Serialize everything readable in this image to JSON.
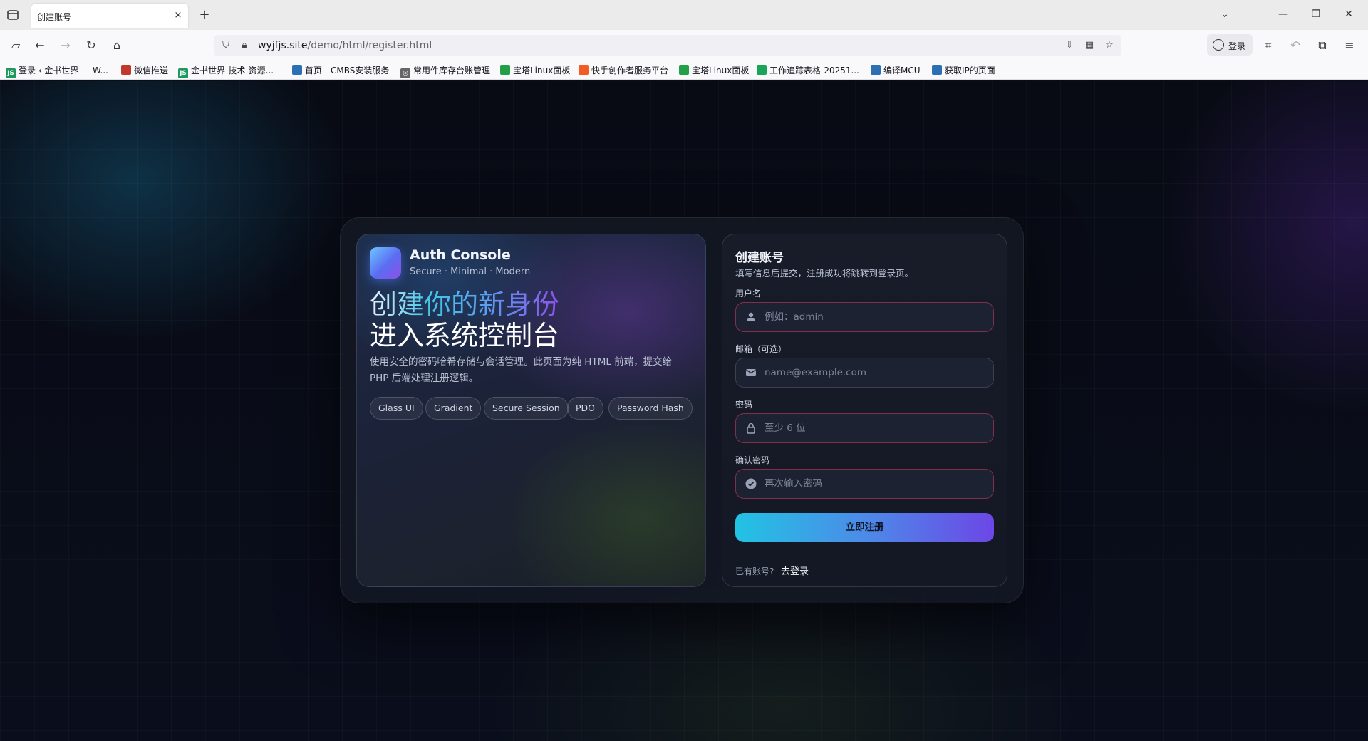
{
  "browser": {
    "tab_title": "创建账号",
    "tab_close": "×",
    "new_tab": "+",
    "url_domain": "wyjfjs.site",
    "url_path": "/demo/html/register.html",
    "login_label": "登录",
    "bookmarks": [
      {
        "label": "登录 ‹ 金书世界 — W...",
        "color": "#1a9a5c",
        "glyph": "JS"
      },
      {
        "label": "微信推送",
        "color": "#c0392b",
        "glyph": ""
      },
      {
        "label": "金书世界-技术-资源...",
        "color": "#1a9a5c",
        "glyph": "JS"
      },
      {
        "label": "首页 - CMBS安装服务",
        "color": "#2d6fb3",
        "glyph": ""
      },
      {
        "label": "常用件库存台账管理",
        "color": "#666666",
        "glyph": "◎"
      },
      {
        "label": "宝塔Linux面板",
        "color": "#22a046",
        "glyph": ""
      },
      {
        "label": "快手创作者服务平台",
        "color": "#f25b21",
        "glyph": ""
      },
      {
        "label": "宝塔Linux面板",
        "color": "#22a046",
        "glyph": ""
      },
      {
        "label": "工作追踪表格-20251...",
        "color": "#18a558",
        "glyph": ""
      },
      {
        "label": "编译MCU",
        "color": "#2d6fb3",
        "glyph": ""
      },
      {
        "label": "获取IP的页面",
        "color": "#2d6fb3",
        "glyph": ""
      }
    ]
  },
  "hero": {
    "brand_name": "Auth Console",
    "brand_tagline": "Secure · Minimal · Modern",
    "headline_line1": "创建你的新身份",
    "headline_line2": "进入系统控制台",
    "description": "使用安全的密码哈希存储与会话管理。此页面为纯 HTML 前端，提交给 PHP 后端处理注册逻辑。",
    "chips": [
      "Glass UI",
      "Gradient",
      "Secure Session",
      "PDO",
      "Password Hash"
    ]
  },
  "form": {
    "title": "创建账号",
    "subtitle": "填写信息后提交，注册成功将跳转到登录页。",
    "fields": [
      {
        "label": "用户名",
        "placeholder": "例如：admin",
        "icon": "user-icon"
      },
      {
        "label": "邮箱（可选）",
        "placeholder": "name@example.com",
        "icon": "mail-icon"
      },
      {
        "label": "密码",
        "placeholder": "至少 6 位",
        "icon": "lock-icon"
      },
      {
        "label": "确认密码",
        "placeholder": "再次输入密码",
        "icon": "check-circle-icon"
      }
    ],
    "submit_label": "立即注册",
    "footer_text": "已有账号?",
    "footer_link": "去登录"
  }
}
